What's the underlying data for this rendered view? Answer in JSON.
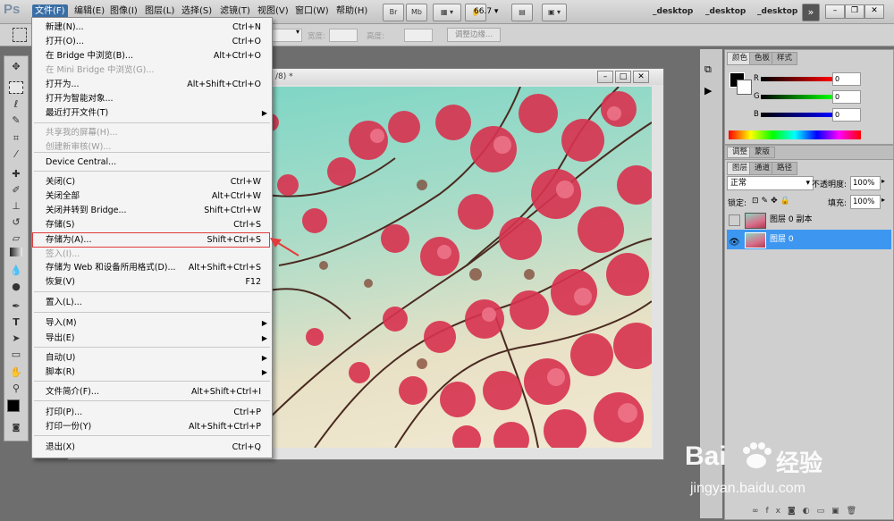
{
  "menubar": {
    "logo": "Ps",
    "items": [
      "文件(F)",
      "编辑(E)",
      "图像(I)",
      "图层(L)",
      "选择(S)",
      "滤镜(T)",
      "视图(V)",
      "窗口(W)",
      "帮助(H)"
    ],
    "zoom": "66.7",
    "bridge": "Br",
    "minibridge": "Mb",
    "workspaces": [
      "_desktop",
      "_desktop",
      "_desktop"
    ]
  },
  "options": {
    "width_label": "宽度:",
    "height_label": "高度:",
    "refine_button": "调整边缘..."
  },
  "document": {
    "title_suffix": "/8) *"
  },
  "file_menu": {
    "items": [
      {
        "label": "新建(N)...",
        "shortcut": "Ctrl+N"
      },
      {
        "label": "打开(O)...",
        "shortcut": "Ctrl+O"
      },
      {
        "label": "在 Bridge 中浏览(B)...",
        "shortcut": "Alt+Ctrl+O"
      },
      {
        "label": "在 Mini Bridge 中浏览(G)...",
        "shortcut": ""
      },
      {
        "label": "打开为...",
        "shortcut": "Alt+Shift+Ctrl+O"
      },
      {
        "label": "打开为智能对象...",
        "shortcut": ""
      },
      {
        "label": "最近打开文件(T)",
        "shortcut": ""
      },
      {
        "label": "共享我的屏幕(H)...",
        "shortcut": ""
      },
      {
        "label": "创建新审核(W)...",
        "shortcut": ""
      },
      {
        "label": "Device Central...",
        "shortcut": ""
      },
      {
        "label": "关闭(C)",
        "shortcut": "Ctrl+W"
      },
      {
        "label": "关闭全部",
        "shortcut": "Alt+Ctrl+W"
      },
      {
        "label": "关闭并转到 Bridge...",
        "shortcut": "Shift+Ctrl+W"
      },
      {
        "label": "存储(S)",
        "shortcut": "Ctrl+S"
      },
      {
        "label": "存储为(A)...",
        "shortcut": "Shift+Ctrl+S"
      },
      {
        "label": "签入(I)...",
        "shortcut": ""
      },
      {
        "label": "存储为 Web 和设备所用格式(D)...",
        "shortcut": "Alt+Shift+Ctrl+S"
      },
      {
        "label": "恢复(V)",
        "shortcut": "F12"
      },
      {
        "label": "置入(L)...",
        "shortcut": ""
      },
      {
        "label": "导入(M)",
        "shortcut": ""
      },
      {
        "label": "导出(E)",
        "shortcut": ""
      },
      {
        "label": "自动(U)",
        "shortcut": ""
      },
      {
        "label": "脚本(R)",
        "shortcut": ""
      },
      {
        "label": "文件简介(F)...",
        "shortcut": "Alt+Shift+Ctrl+I"
      },
      {
        "label": "打印(P)...",
        "shortcut": "Ctrl+P"
      },
      {
        "label": "打印一份(Y)",
        "shortcut": "Alt+Shift+Ctrl+P"
      },
      {
        "label": "退出(X)",
        "shortcut": "Ctrl+Q"
      }
    ]
  },
  "color_panel": {
    "tabs": [
      "颜色",
      "色板",
      "样式"
    ],
    "channels": [
      {
        "label": "R",
        "value": "0"
      },
      {
        "label": "G",
        "value": "0"
      },
      {
        "label": "B",
        "value": "0"
      }
    ]
  },
  "adjust_panel": {
    "tabs": [
      "调整",
      "蒙版"
    ]
  },
  "layers_panel": {
    "tabs": [
      "图层",
      "通道",
      "路径"
    ],
    "blend_mode": "正常",
    "opacity_label": "不透明度:",
    "opacity": "100%",
    "lock_label": "锁定:",
    "fill_label": "填充:",
    "fill": "100%",
    "layers": [
      {
        "name": "图层 0 副本",
        "visible": false,
        "selected": false
      },
      {
        "name": "图层 0",
        "visible": true,
        "selected": true
      }
    ]
  },
  "watermark": {
    "brand": "Bai",
    "brand2": "经验",
    "url": "jingyan.baidu.com"
  },
  "colors": {
    "highlight": "#e23b3b",
    "selected_layer": "#3d97f0",
    "menu_active": "#3a6ea5"
  }
}
